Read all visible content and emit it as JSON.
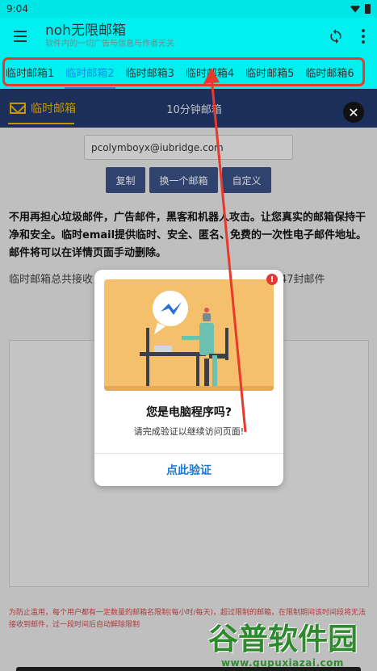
{
  "status_bar": {
    "time": "9:04",
    "wifi_icon": "wifi-icon",
    "battery_icon": "battery-icon"
  },
  "app_bar": {
    "title": "noh无限邮箱",
    "subtitle": "软件内的一切广告与信息与作者无关",
    "menu_icon": "hamburger-icon",
    "refresh_icon": "refresh-icon",
    "more_icon": "more-vert-icon"
  },
  "tabs": [
    {
      "label": "临时邮箱1",
      "active": false
    },
    {
      "label": "临时邮箱2",
      "active": true
    },
    {
      "label": "临时邮箱3",
      "active": false
    },
    {
      "label": "临时邮箱4",
      "active": false
    },
    {
      "label": "临时邮箱5",
      "active": false
    },
    {
      "label": "临时邮箱6",
      "active": false
    }
  ],
  "site_nav": {
    "left_label": "临时邮箱",
    "center_label": "10分钟邮箱",
    "close_label": "✕"
  },
  "email": {
    "address": "pcolymboyx@iubridge.com"
  },
  "buttons": {
    "copy": "复制",
    "change": "换一个邮箱",
    "custom": "自定义"
  },
  "description": "不用再担心垃圾邮件，广告邮件，黑客和机器人攻击。让您真实的邮箱保持干净和安全。临时email提供临时、安全、匿名、免费的一次性电子邮件地址。邮件将可以在详情页面手动删除。",
  "count": {
    "left": "临时邮箱总共接收",
    "right": "47封邮件"
  },
  "warning": "为防止滥用，每个用户都有一定数量的邮箱名限制(每小时/每天)，超过限制的邮箱，在限制期间该时间段将无法接收到邮件，过一段时间后自动解除限制",
  "modal": {
    "title": "您是电脑程序吗?",
    "subtitle": "请完成验证以继续访问页面!",
    "button": "点此验证",
    "alert": "!"
  },
  "watermark": {
    "main": "谷普软件园",
    "url": "www.gupuxiazai.com"
  },
  "colors": {
    "accent": "#00f0f0",
    "nav": "#233a6e",
    "tab_active": "#1e88e5",
    "highlight_frame": "#e8392c"
  }
}
